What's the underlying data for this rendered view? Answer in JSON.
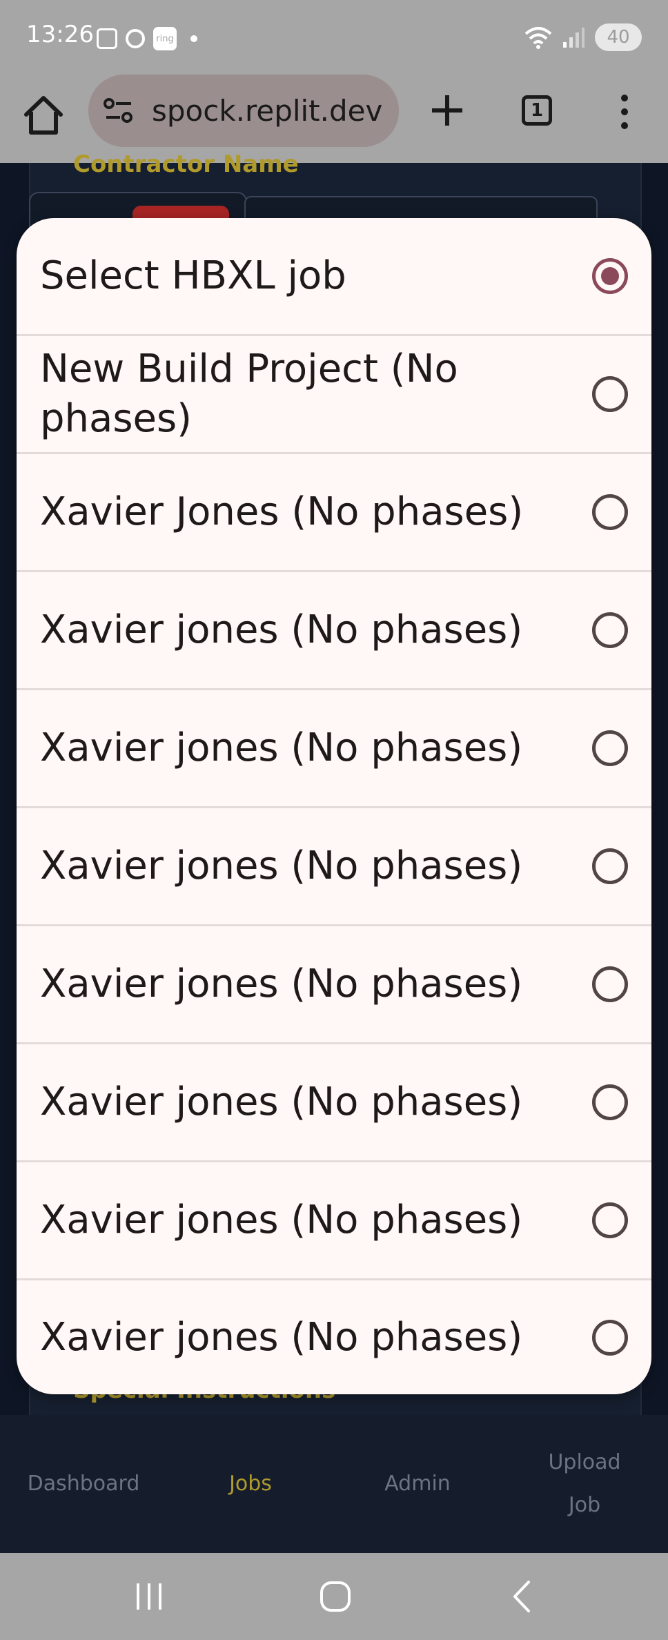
{
  "status_bar": {
    "time": "13:26",
    "ring_label": "ring",
    "battery": "40"
  },
  "browser": {
    "url": "spock.replit.dev",
    "tab_count": "1"
  },
  "page": {
    "contractor_label": "Contractor Name",
    "special_label": "Special Instructions"
  },
  "dropdown": {
    "options": [
      {
        "label": "Select HBXL job",
        "selected": true
      },
      {
        "label": "New Build Project (No phases)",
        "selected": false
      },
      {
        "label": "Xavier Jones (No phases)",
        "selected": false
      },
      {
        "label": "Xavier jones (No phases)",
        "selected": false
      },
      {
        "label": "Xavier jones (No phases)",
        "selected": false
      },
      {
        "label": "Xavier jones (No phases)",
        "selected": false
      },
      {
        "label": "Xavier jones (No phases)",
        "selected": false
      },
      {
        "label": "Xavier jones (No phases)",
        "selected": false
      },
      {
        "label": "Xavier jones (No phases)",
        "selected": false
      },
      {
        "label": "Xavier jones (No phases)",
        "selected": false
      }
    ]
  },
  "bottom_nav": {
    "dashboard": "Dashboard",
    "jobs": "Jobs",
    "admin": "Admin",
    "upload_line1": "Upload",
    "upload_line2": "Job"
  },
  "colors": {
    "accent": "#b09a2c",
    "radio_selected": "#8b4a5a",
    "sheet_bg": "#fff8f6",
    "page_bg": "#0e1524"
  }
}
